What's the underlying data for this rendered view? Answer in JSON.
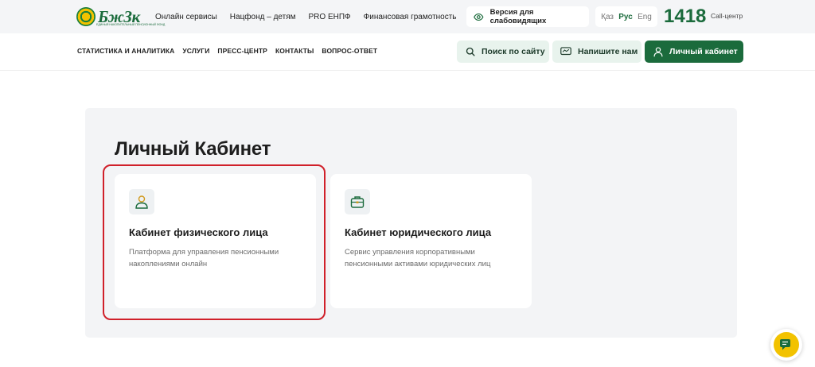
{
  "header": {
    "logo_text": "БжЗк",
    "logo_subtitle": "ЕДИНЫЙ НАКОПИТЕЛЬНЫЙ ПЕНСИОННЫЙ ФОНД",
    "top_links": [
      "Онлайн сервисы",
      "Нацфонд – детям",
      "PRO ЕНПФ",
      "Финансовая грамотность"
    ],
    "vision_label": "Версия для слабовидящих",
    "languages": [
      {
        "label": "Қаз",
        "active": false
      },
      {
        "label": "Рус",
        "active": true
      },
      {
        "label": "Eng",
        "active": false
      }
    ],
    "call_number": "1418",
    "call_label": "Call-центр"
  },
  "main_nav": [
    "СТАТИСТИКА И АНАЛИТИКА",
    "УСЛУГИ",
    "ПРЕСС-ЦЕНТР",
    "КОНТАКТЫ",
    "ВОПРОС-ОТВЕТ"
  ],
  "actions": {
    "search_label": "Поиск по сайту",
    "write_label": "Напишите нам",
    "cabinet_label": "Личный кабинет"
  },
  "content": {
    "title": "Личный Кабинет",
    "cards": [
      {
        "title": "Кабинет физического лица",
        "desc": "Платформа для управления пенсионными накоплениями онлайн",
        "icon": "person-icon"
      },
      {
        "title": "Кабинет юридического лица",
        "desc": "Сервис управления корпоративными пенсионными активами юридических лиц",
        "icon": "briefcase-icon"
      }
    ]
  },
  "colors": {
    "brand_green": "#1b6b3c",
    "brand_yellow": "#f2c200",
    "highlight_red": "#d0202a"
  }
}
